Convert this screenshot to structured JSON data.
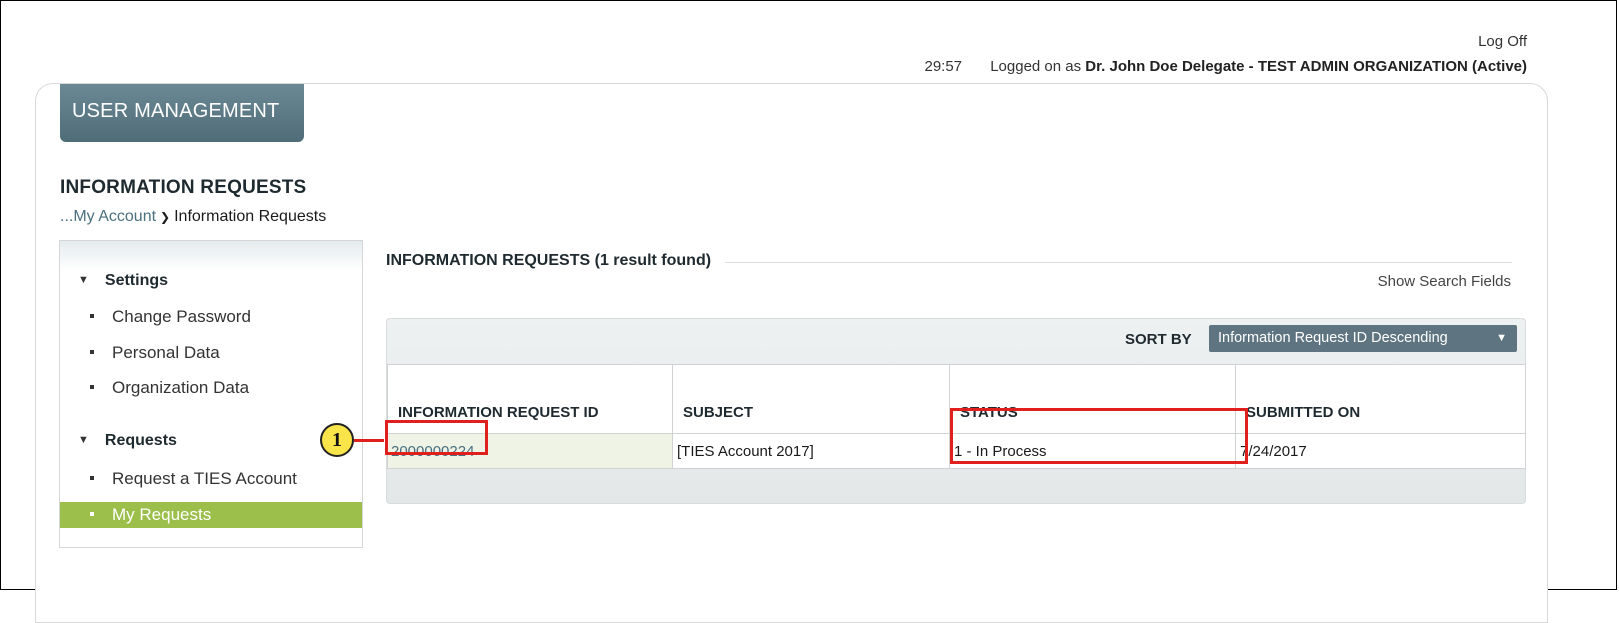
{
  "header": {
    "log_off": "Log Off",
    "session_timer": "29:57",
    "logged_on_prefix": "Logged on as",
    "user": "Dr. John Doe Delegate - TEST ADMIN ORGANIZATION (Active)"
  },
  "module_tab": "USER MANAGEMENT",
  "page_title": "INFORMATION REQUESTS",
  "breadcrumb": {
    "parent": "...My Account",
    "current": "Information Requests"
  },
  "sidebar": {
    "sections": [
      {
        "title": "Settings",
        "items": [
          "Change Password",
          "Personal Data",
          "Organization Data"
        ]
      },
      {
        "title": "Requests",
        "items": [
          "Request a TIES Account",
          "My Requests"
        ]
      }
    ],
    "active_item": "My Requests"
  },
  "results": {
    "title": "INFORMATION REQUESTS",
    "count_text": "(1 result found)",
    "show_search_fields": "Show Search Fields",
    "sort_by_label": "SORT BY",
    "sort_value": "Information Request ID Descending",
    "columns": [
      "INFORMATION REQUEST ID",
      "SUBJECT",
      "STATUS",
      "SUBMITTED ON"
    ],
    "rows": [
      {
        "id": "2000000224",
        "subject": "[TIES Account 2017]",
        "status": "1 - In Process",
        "submitted_on": "7/24/2017"
      }
    ]
  },
  "annotation": {
    "callout_number": "1",
    "highlight_color": "#e0201d",
    "callout_color": "#f9e44a"
  },
  "colors": {
    "tab_bg": "#5b7985",
    "active_nav": "#9bbf4a",
    "link": "#4a6f7f",
    "sort_select_bg": "#5e7480"
  },
  "icons": {
    "section_expand": "triangle-down-icon",
    "breadcrumb_separator": "chevron-right-icon",
    "sort_dropdown": "caret-down-icon"
  }
}
